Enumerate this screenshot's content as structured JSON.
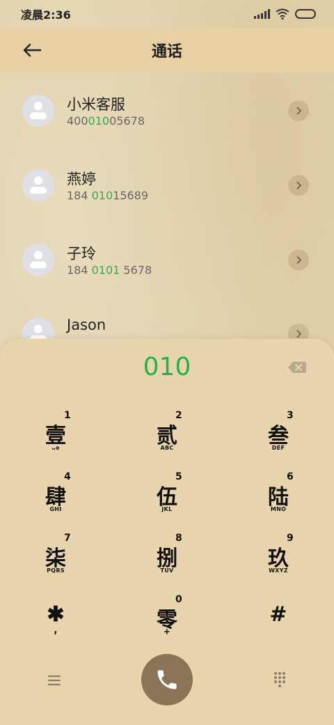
{
  "status_bar": {
    "time": "凌晨2:36"
  },
  "header": {
    "title": "通话"
  },
  "contacts": [
    {
      "name": "小米客服",
      "number_pre": "400",
      "number_match": "010",
      "number_post": "05678"
    },
    {
      "name": "燕婷",
      "number_pre": "184 ",
      "number_match": "010",
      "number_post": "15689"
    },
    {
      "name": "子玲",
      "number_pre": "184 ",
      "number_match": "0101",
      "number_post": " 5678"
    },
    {
      "name": "Jason",
      "number_pre": "",
      "number_match": "",
      "number_post": ""
    }
  ],
  "dialpad": {
    "dialed_number": "010",
    "keys": [
      {
        "glyph": "壹",
        "digit": "1",
        "letters": "ᴗᴑ"
      },
      {
        "glyph": "贰",
        "digit": "2",
        "letters": "ABC"
      },
      {
        "glyph": "叁",
        "digit": "3",
        "letters": "DEF"
      },
      {
        "glyph": "肆",
        "digit": "4",
        "letters": "GHI"
      },
      {
        "glyph": "伍",
        "digit": "5",
        "letters": "JKL"
      },
      {
        "glyph": "陆",
        "digit": "6",
        "letters": "MNO"
      },
      {
        "glyph": "柒",
        "digit": "7",
        "letters": "PQRS"
      },
      {
        "glyph": "捌",
        "digit": "8",
        "letters": "TUV"
      },
      {
        "glyph": "玖",
        "digit": "9",
        "letters": "WXYZ"
      },
      {
        "glyph": "✱",
        "digit": "",
        "letters": ","
      },
      {
        "glyph": "零",
        "digit": "0",
        "letters": "+"
      },
      {
        "glyph": "#",
        "digit": "",
        "letters": ""
      }
    ]
  },
  "icons": {
    "back": "arrow-left-icon",
    "detail": "chevron-right-icon",
    "backspace": "backspace-icon",
    "menu": "menu-icon",
    "call": "phone-icon",
    "dialpad_toggle": "dialpad-icon"
  },
  "colors": {
    "accent_green": "#22b14c",
    "call_button": "#8b7355",
    "header_bg": "#e6d0a4",
    "dialpad_bg": "#e8d5ad"
  }
}
